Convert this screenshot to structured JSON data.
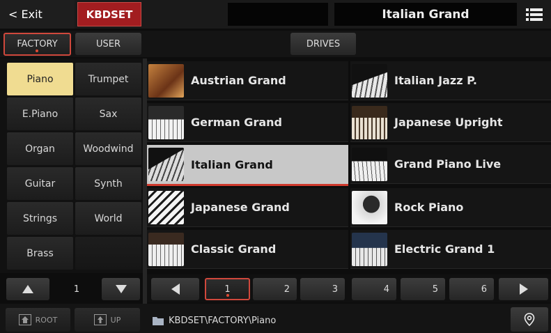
{
  "header": {
    "exit_label": "< Exit",
    "mode_label": "KBDSET",
    "current_sound": "Italian Grand"
  },
  "tabs": {
    "factory": "FACTORY",
    "user": "USER",
    "drives": "DRIVES"
  },
  "categories": [
    {
      "label": "Piano"
    },
    {
      "label": "Trumpet"
    },
    {
      "label": "E.Piano"
    },
    {
      "label": "Sax"
    },
    {
      "label": "Organ"
    },
    {
      "label": "Woodwind"
    },
    {
      "label": "Guitar"
    },
    {
      "label": "Synth"
    },
    {
      "label": "Strings"
    },
    {
      "label": "World"
    },
    {
      "label": "Brass"
    }
  ],
  "selected_category": "Piano",
  "sounds": [
    {
      "name": "Austrian Grand"
    },
    {
      "name": "Italian Jazz P."
    },
    {
      "name": "German Grand"
    },
    {
      "name": "Japanese Upright"
    },
    {
      "name": "Italian Grand"
    },
    {
      "name": "Grand Piano Live"
    },
    {
      "name": "Japanese Grand"
    },
    {
      "name": "Rock Piano"
    },
    {
      "name": "Classic Grand"
    },
    {
      "name": "Electric Grand 1"
    }
  ],
  "selected_sound": "Italian Grand",
  "category_page": "1",
  "pages": [
    "1",
    "2",
    "3",
    "4",
    "5",
    "6"
  ],
  "selected_page": "1",
  "bottom": {
    "root_label": "ROOT",
    "up_label": "UP",
    "path": "KBDSET\\FACTORY\\Piano"
  },
  "colors": {
    "accent_red": "#a21d20",
    "selected_category": "#f0dc91",
    "selected_sound": "#c8c8c8"
  }
}
